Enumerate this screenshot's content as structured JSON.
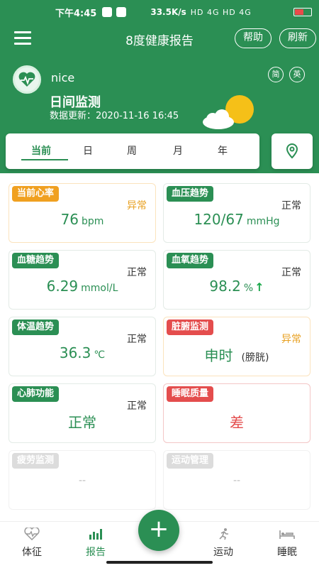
{
  "status_bar": {
    "time": "下午4:45",
    "network_speed": "33.5K/s",
    "signal": "HD 4G HD 4G"
  },
  "header": {
    "title": "8度健康报告",
    "help_label": "帮助",
    "refresh_label": "刷新"
  },
  "profile": {
    "username": "nice",
    "monitor_title": "日间监测",
    "update_label": "数据更新：",
    "update_time": "2020-11-16 16:45",
    "lang_simplified": "简",
    "lang_english": "英"
  },
  "tabs": [
    "当前",
    "日",
    "周",
    "月",
    "年"
  ],
  "cards": {
    "heart_rate": {
      "tag": "当前心率",
      "status": "异常",
      "value": "76",
      "unit": "bpm"
    },
    "blood_pressure": {
      "tag": "血压趋势",
      "status": "正常",
      "value": "120/67",
      "unit": "mmHg"
    },
    "blood_sugar": {
      "tag": "血糖趋势",
      "status": "正常",
      "value": "6.29",
      "unit": "mmol/L"
    },
    "blood_oxygen": {
      "tag": "血氧趋势",
      "status": "正常",
      "value": "98.2",
      "unit": "%",
      "arrow": "↑"
    },
    "temperature": {
      "tag": "体温趋势",
      "status": "正常",
      "value": "36.3",
      "unit": "℃"
    },
    "organ": {
      "tag": "脏腑监测",
      "status": "异常",
      "value": "申时",
      "sub": "(膀胱)"
    },
    "cardio": {
      "tag": "心肺功能",
      "status": "正常",
      "value": "正常"
    },
    "sleep": {
      "tag": "睡眠质量",
      "value": "差"
    },
    "fatigue": {
      "tag": "疲劳监测",
      "value": "--"
    },
    "exercise": {
      "tag": "运动管理",
      "value": "--"
    }
  },
  "bottom_nav": {
    "vitals": "体征",
    "report": "报告",
    "add": "+",
    "sport": "运动",
    "sleep": "睡眠"
  },
  "colors": {
    "primary": "#2b8f54",
    "warning": "#f0a020",
    "danger": "#e44d4d"
  }
}
